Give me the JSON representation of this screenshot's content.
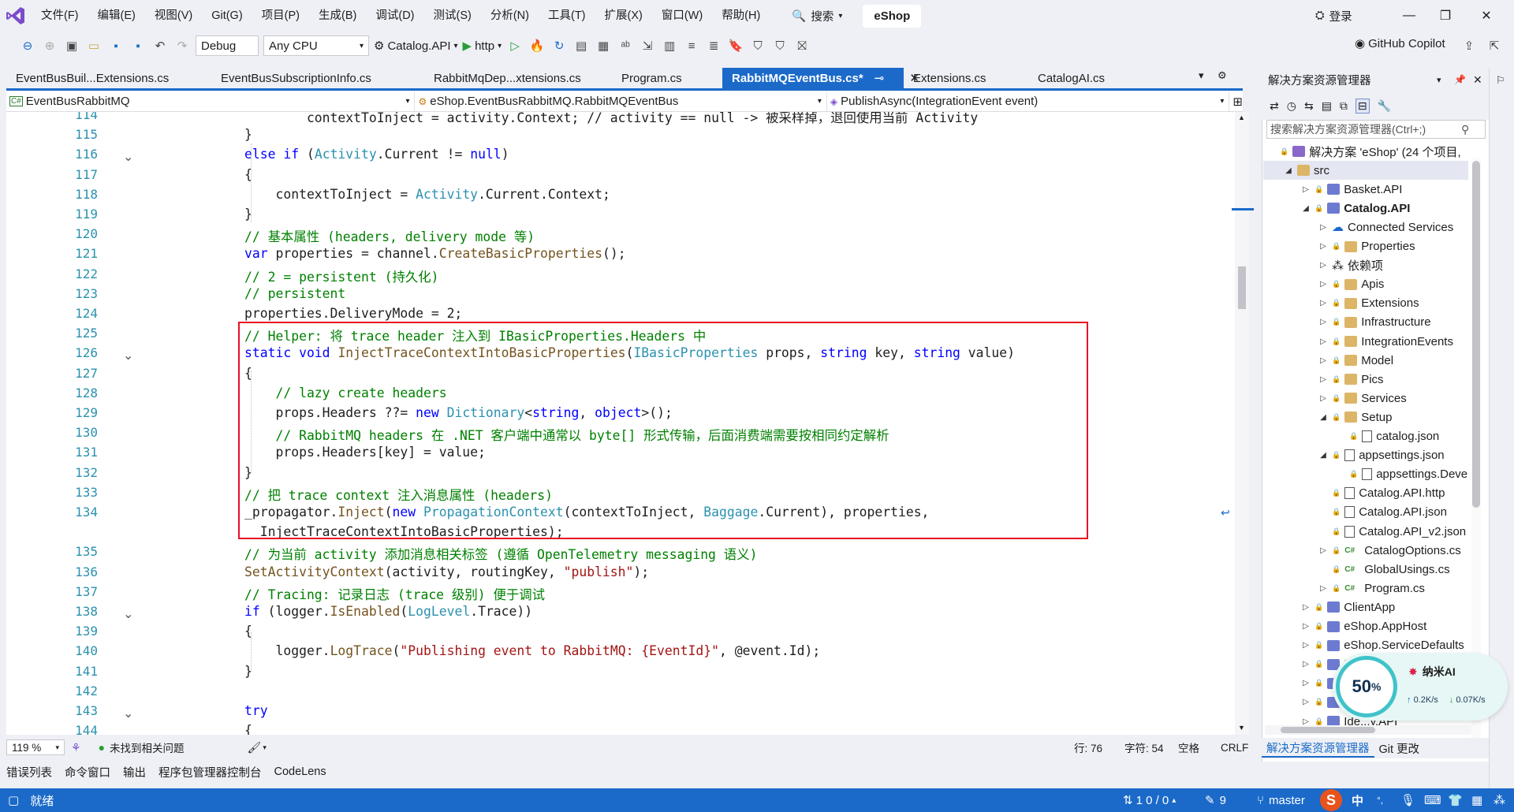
{
  "menu": {
    "items": [
      "文件(F)",
      "编辑(E)",
      "视图(V)",
      "Git(G)",
      "项目(P)",
      "生成(B)",
      "调试(D)",
      "测试(S)",
      "分析(N)",
      "工具(T)",
      "扩展(X)",
      "窗口(W)",
      "帮助(H)"
    ],
    "search_label": "搜索",
    "solution_name": "eShop",
    "login_label": "登录"
  },
  "toolbar": {
    "config": "Debug",
    "platform": "Any CPU",
    "startup_project": "Catalog.API",
    "launch_profile": "http",
    "copilot_label": "GitHub Copilot"
  },
  "tabs": [
    {
      "label": "EventBusBuil...Extensions.cs",
      "active": false
    },
    {
      "label": "EventBusSubscriptionInfo.cs",
      "active": false
    },
    {
      "label": "RabbitMqDep...xtensions.cs",
      "active": false
    },
    {
      "label": "Program.cs",
      "active": false
    },
    {
      "label": "RabbitMQEventBus.cs*",
      "active": true
    },
    {
      "label": "Extensions.cs",
      "active": false
    },
    {
      "label": "CatalogAI.cs",
      "active": false
    }
  ],
  "navbar": {
    "project": "EventBusRabbitMQ",
    "type": "eShop.EventBusRabbitMQ.RabbitMQEventBus",
    "member": "PublishAsync(IntegrationEvent event)"
  },
  "editor": {
    "lines": [
      {
        "n": "114",
        "tokens": [
          [
            "",
            "        contextToInject = activity.Context; // activity == null -> 被采样掉，退回使用当前 Activity"
          ]
        ]
      },
      {
        "n": "115",
        "tokens": [
          [
            "",
            "}"
          ]
        ]
      },
      {
        "n": "116",
        "tokens": [
          [
            "kw",
            "else if"
          ],
          [
            "",
            " ("
          ],
          [
            "ty",
            "Activity"
          ],
          [
            "",
            ".Current != "
          ],
          [
            "kw",
            "null"
          ],
          [
            "",
            ")"
          ]
        ]
      },
      {
        "n": "117",
        "tokens": [
          [
            "",
            "{"
          ]
        ]
      },
      {
        "n": "118",
        "tokens": [
          [
            "",
            "    contextToInject = "
          ],
          [
            "ty",
            "Activity"
          ],
          [
            "",
            ".Current.Context;"
          ]
        ]
      },
      {
        "n": "119",
        "tokens": [
          [
            "",
            "}"
          ]
        ]
      },
      {
        "n": "120",
        "tokens": [
          [
            "cm",
            "// 基本属性 (headers, delivery mode 等)"
          ]
        ]
      },
      {
        "n": "121",
        "tokens": [
          [
            "kw",
            "var"
          ],
          [
            "",
            " properties = channel."
          ],
          [
            "fn",
            "CreateBasicProperties"
          ],
          [
            "",
            "();"
          ]
        ]
      },
      {
        "n": "122",
        "tokens": [
          [
            "cm",
            "// 2 = persistent (持久化)"
          ]
        ]
      },
      {
        "n": "123",
        "tokens": [
          [
            "cm",
            "// persistent"
          ]
        ]
      },
      {
        "n": "124",
        "tokens": [
          [
            "",
            "properties.DeliveryMode = 2;"
          ]
        ]
      },
      {
        "n": "125",
        "tokens": [
          [
            "cm",
            "// Helper: 将 trace header 注入到 IBasicProperties.Headers 中"
          ]
        ]
      },
      {
        "n": "126",
        "tokens": [
          [
            "kw",
            "static void"
          ],
          [
            "",
            " "
          ],
          [
            "fn",
            "InjectTraceContextIntoBasicProperties"
          ],
          [
            "",
            "("
          ],
          [
            "ty",
            "IBasicProperties"
          ],
          [
            "",
            " props, "
          ],
          [
            "kw",
            "string"
          ],
          [
            "",
            " key, "
          ],
          [
            "kw",
            "string"
          ],
          [
            "",
            " value)"
          ]
        ]
      },
      {
        "n": "127",
        "tokens": [
          [
            "",
            "{"
          ]
        ]
      },
      {
        "n": "128",
        "tokens": [
          [
            "cm",
            "    // lazy create headers"
          ]
        ]
      },
      {
        "n": "129",
        "tokens": [
          [
            "",
            "    props.Headers ??= "
          ],
          [
            "kw",
            "new"
          ],
          [
            "",
            " "
          ],
          [
            "ty",
            "Dictionary"
          ],
          [
            "",
            "<"
          ],
          [
            "kw",
            "string"
          ],
          [
            "",
            ", "
          ],
          [
            "kw",
            "object"
          ],
          [
            "",
            ">();"
          ]
        ]
      },
      {
        "n": "130",
        "tokens": [
          [
            "cm",
            "    // RabbitMQ headers 在 .NET 客户端中通常以 byte[] 形式传输，后面消费端需要按相同约定解析"
          ]
        ]
      },
      {
        "n": "131",
        "tokens": [
          [
            "",
            "    props.Headers[key] = value;"
          ]
        ]
      },
      {
        "n": "132",
        "tokens": [
          [
            "",
            "}"
          ]
        ]
      },
      {
        "n": "133",
        "tokens": [
          [
            "cm",
            "// 把 trace context 注入消息属性 (headers)"
          ]
        ]
      },
      {
        "n": "134",
        "tokens": [
          [
            "",
            "_propagator."
          ],
          [
            "fn",
            "Inject"
          ],
          [
            "",
            "("
          ],
          [
            "kw",
            "new"
          ],
          [
            "",
            " "
          ],
          [
            "ty",
            "PropagationContext"
          ],
          [
            "",
            "(contextToInject, "
          ],
          [
            "ty",
            "Baggage"
          ],
          [
            "",
            ".Current), properties,"
          ]
        ]
      },
      {
        "n": "",
        "tokens": [
          [
            "",
            "  InjectTraceContextIntoBasicProperties);"
          ]
        ]
      },
      {
        "n": "135",
        "tokens": [
          [
            "cm",
            "// 为当前 activity 添加消息相关标签 (遵循 OpenTelemetry messaging 语义)"
          ]
        ]
      },
      {
        "n": "136",
        "tokens": [
          [
            "fn",
            "SetActivityContext"
          ],
          [
            "",
            "(activity, routingKey, "
          ],
          [
            "st",
            "\"publish\""
          ],
          [
            "",
            ");"
          ]
        ]
      },
      {
        "n": "137",
        "tokens": [
          [
            "cm",
            "// Tracing: 记录日志 (trace 级别) 便于调试"
          ]
        ]
      },
      {
        "n": "138",
        "tokens": [
          [
            "kw",
            "if"
          ],
          [
            "",
            " (logger."
          ],
          [
            "fn",
            "IsEnabled"
          ],
          [
            "",
            "("
          ],
          [
            "ty",
            "LogLevel"
          ],
          [
            "",
            ".Trace))"
          ]
        ]
      },
      {
        "n": "139",
        "tokens": [
          [
            "",
            "{"
          ]
        ]
      },
      {
        "n": "140",
        "tokens": [
          [
            "",
            "    logger."
          ],
          [
            "fn",
            "LogTrace"
          ],
          [
            "",
            "("
          ],
          [
            "st",
            "\"Publishing event to RabbitMQ: {EventId}\""
          ],
          [
            "",
            ", @event.Id);"
          ]
        ]
      },
      {
        "n": "141",
        "tokens": [
          [
            "",
            "}"
          ]
        ]
      },
      {
        "n": "142",
        "tokens": [
          [
            "",
            ""
          ]
        ]
      },
      {
        "n": "143",
        "tokens": [
          [
            "kw",
            "try"
          ]
        ]
      },
      {
        "n": "144",
        "tokens": [
          [
            "",
            "{"
          ]
        ]
      }
    ]
  },
  "editor_status": {
    "zoom": "119 %",
    "issues": "未找到相关问题",
    "line": "行: 76",
    "col": "字符: 54",
    "whitespace": "空格",
    "eol": "CRLF"
  },
  "tool_tabs": [
    "错误列表",
    "命令窗口",
    "输出",
    "程序包管理器控制台",
    "CodeLens"
  ],
  "statusbar": {
    "ready": "就绪",
    "sync": "1 0 / 0",
    "edits": "9",
    "branch": "master",
    "ime": "中"
  },
  "solution_explorer": {
    "title": "解决方案资源管理器",
    "search_placeholder": "搜索解决方案资源管理器(Ctrl+;)",
    "footer_tab1": "解决方案资源管理器",
    "footer_tab2": "Git 更改",
    "items": [
      {
        "label": "解决方案 'eShop' (24 个项目,",
        "depth": 0,
        "exp": "",
        "icon": "solution",
        "lock": true
      },
      {
        "label": "src",
        "depth": 1,
        "exp": "◢",
        "icon": "folder",
        "lock": false,
        "sel": true
      },
      {
        "label": "Basket.API",
        "depth": 2,
        "exp": "▷",
        "icon": "proj",
        "lock": true
      },
      {
        "label": "Catalog.API",
        "depth": 2,
        "exp": "◢",
        "icon": "proj",
        "lock": true,
        "bold": true
      },
      {
        "label": "Connected Services",
        "depth": 3,
        "exp": "▷",
        "icon": "cloud",
        "lock": false
      },
      {
        "label": "Properties",
        "depth": 3,
        "exp": "▷",
        "icon": "folder",
        "lock": true
      },
      {
        "label": "依赖项",
        "depth": 3,
        "exp": "▷",
        "icon": "deps",
        "lock": false
      },
      {
        "label": "Apis",
        "depth": 3,
        "exp": "▷",
        "icon": "folder",
        "lock": true
      },
      {
        "label": "Extensions",
        "depth": 3,
        "exp": "▷",
        "icon": "folder",
        "lock": true
      },
      {
        "label": "Infrastructure",
        "depth": 3,
        "exp": "▷",
        "icon": "folder",
        "lock": true
      },
      {
        "label": "IntegrationEvents",
        "depth": 3,
        "exp": "▷",
        "icon": "folder",
        "lock": true
      },
      {
        "label": "Model",
        "depth": 3,
        "exp": "▷",
        "icon": "folder",
        "lock": true
      },
      {
        "label": "Pics",
        "depth": 3,
        "exp": "▷",
        "icon": "folder",
        "lock": true
      },
      {
        "label": "Services",
        "depth": 3,
        "exp": "▷",
        "icon": "folder",
        "lock": true
      },
      {
        "label": "Setup",
        "depth": 3,
        "exp": "◢",
        "icon": "folder",
        "lock": true
      },
      {
        "label": "catalog.json",
        "depth": 4,
        "exp": "",
        "icon": "file",
        "lock": true
      },
      {
        "label": "appsettings.json",
        "depth": 3,
        "exp": "◢",
        "icon": "file",
        "lock": true
      },
      {
        "label": "appsettings.Deve",
        "depth": 4,
        "exp": "",
        "icon": "file",
        "lock": true
      },
      {
        "label": "Catalog.API.http",
        "depth": 3,
        "exp": "",
        "icon": "http",
        "lock": true
      },
      {
        "label": "Catalog.API.json",
        "depth": 3,
        "exp": "",
        "icon": "file",
        "lock": true
      },
      {
        "label": "Catalog.API_v2.json",
        "depth": 3,
        "exp": "",
        "icon": "file",
        "lock": true
      },
      {
        "label": "CatalogOptions.cs",
        "depth": 3,
        "exp": "▷",
        "icon": "cs",
        "lock": true
      },
      {
        "label": "GlobalUsings.cs",
        "depth": 3,
        "exp": "",
        "icon": "cs",
        "lock": true
      },
      {
        "label": "Program.cs",
        "depth": 3,
        "exp": "▷",
        "icon": "cs",
        "lock": true
      },
      {
        "label": "ClientApp",
        "depth": 2,
        "exp": "▷",
        "icon": "proj",
        "lock": true
      },
      {
        "label": "eShop.AppHost",
        "depth": 2,
        "exp": "▷",
        "icon": "proj",
        "lock": true
      },
      {
        "label": "eShop.ServiceDefaults",
        "depth": 2,
        "exp": "▷",
        "icon": "proj",
        "lock": true
      },
      {
        "label": "F",
        "depth": 2,
        "exp": "▷",
        "icon": "proj",
        "lock": true
      },
      {
        "label": "",
        "depth": 2,
        "exp": "▷",
        "icon": "proj",
        "lock": true
      },
      {
        "label": "",
        "depth": 2,
        "exp": "▷",
        "icon": "proj",
        "lock": true
      },
      {
        "label": "Ide...y.API",
        "depth": 2,
        "exp": "▷",
        "icon": "proj",
        "lock": true
      }
    ]
  },
  "ai_widget": {
    "percent": "50",
    "percent_unit": "%",
    "brand": "纳米AI",
    "upload": "0.2K/s",
    "download": "0.07K/s"
  },
  "colors": {
    "accent": "#1b6ac9",
    "highlight_border": "#e81123",
    "keyword": "#0000ff",
    "type": "#2b91af",
    "comment": "#008000",
    "string": "#a31515"
  }
}
